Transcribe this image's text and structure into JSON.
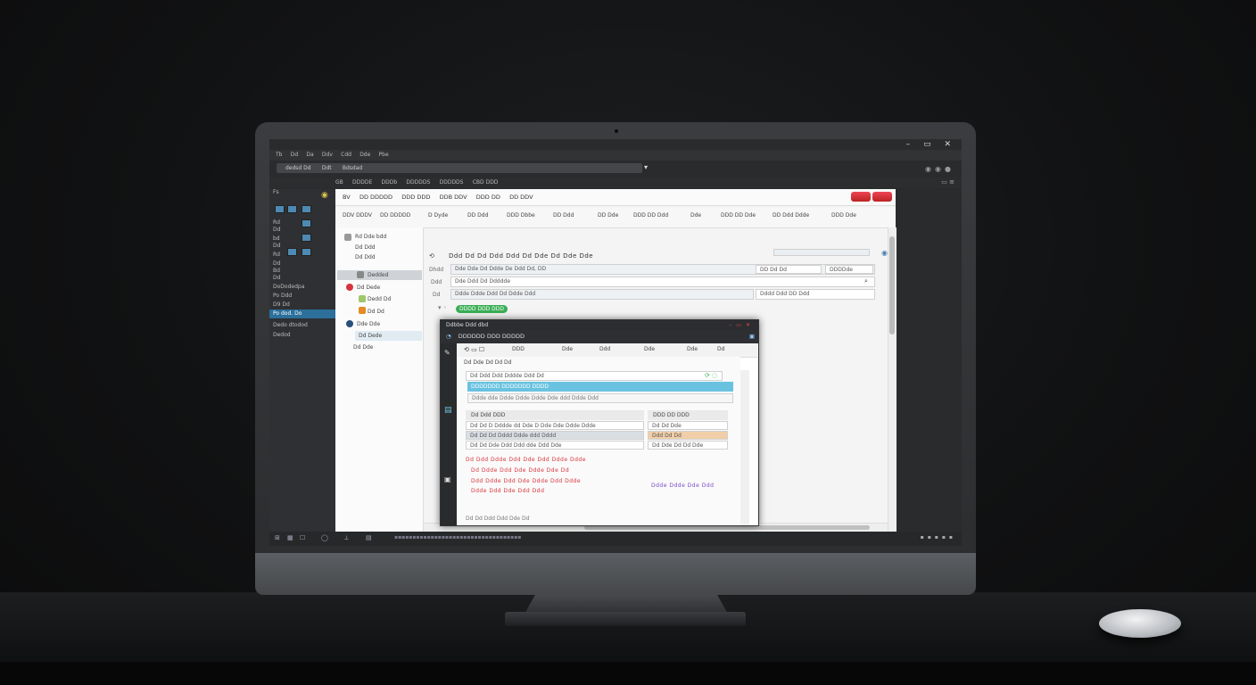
{
  "window": {
    "controls": "– ▭ ✕",
    "menu": [
      "Tb",
      "Dd",
      "Da",
      "Ddv",
      "Cdd",
      "Dde",
      "Pbe"
    ],
    "address": [
      "dedsd Dd",
      "Ddt",
      "Bdsdad"
    ],
    "toolbar": [
      "GB",
      "DDDDE",
      "DDDb",
      "DDDDDS",
      "DDDDDS",
      "CBD DDD"
    ]
  },
  "sidebar": {
    "items": [
      "Fs",
      "Rd",
      "Dd",
      "bd",
      "Dd",
      "Rd",
      "Dd",
      "Bd",
      "Dd",
      "DoDodedpa",
      "Po Ddd",
      "D9 Dd",
      "Po dod. Do",
      "Dedo dtodod",
      "Dedod"
    ]
  },
  "app": {
    "top_menu": [
      "BV",
      "DD DDDDD",
      "DDD DDD",
      "DDB DDV",
      "DDD DD",
      "DD DDV"
    ],
    "tabs": [
      "DDV DDDV",
      "DD DDDDD",
      "D Dyde",
      "DD Ddd",
      "DDD Dbbe",
      "DD Ddd",
      "DD Dde",
      "DDD DD Ddd",
      "Dde",
      "DDD DD Dde",
      "DD Ddd Ddde",
      "DDD Dde"
    ],
    "tree": [
      "Rd Dde bdd",
      "Dd Ddd",
      "Dd Ddd",
      "Dedded",
      "Dd Dede",
      "Dedd Dd",
      "Dd Dd",
      "Dde Dde",
      "Dd Dede",
      "Dd Dde"
    ],
    "heading": "Ddd Dd Dd Ddd Ddd Dd Dde Dd Dde Dde",
    "fields": [
      {
        "label": "Dhdd",
        "value": "Dde Dde Dd Ddde De Ddd Dd, DD",
        "right": "DD Dd  Dd",
        "right2": "DDDDde"
      },
      {
        "label": "Ddd",
        "value": "Dde Ddd Dd Ddddde",
        "right": ""
      },
      {
        "label": "Dd",
        "value": "Ddde Ddde Ddd Dd Ddde Ddd",
        "right": "Dddd Ddd  DD Ddd"
      }
    ],
    "pill": "DDDD DDD DDD"
  },
  "dialog": {
    "title": "Ddbbe Ddd dbd",
    "bar_title": "DDDDDD DDD DDDDD",
    "tabs": [
      "DDD",
      "Dde",
      "Ddd",
      "Dde",
      "Dde",
      "Dd"
    ],
    "search": "Dd Ddd  Ddd Dddde Ddd Dd",
    "blue_band": "DDDDDDD DDDDDDD DDDD",
    "sub": "Ddde dde Ddde Ddde Ddde Dde ddd Ddde Ddd",
    "panel_left_title": "Dd Ddd DDD",
    "panel_right_title": "DDD DD DDD",
    "panel_left_rows": [
      "Dd Dd D Dddde dd Dde D Dde Dde Ddde Ddde",
      "Dd Dd Dd Dddd Ddde ddd Dddd",
      "Dd Dd Dde Ddd Ddd dde Ddd Dde"
    ],
    "panel_right_rows": [
      "Dd Dd Dde",
      "Ddd Dd Dd",
      "Dd Dde Dd Dd Dde"
    ],
    "red_lines": [
      "Dd Ddd Ddde Ddd Dde Ddd Ddde Ddde",
      "Dd Ddde Ddd Dde Ddde Dde Dd",
      "Ddd Ddde Ddd Dde Ddde Ddd Ddde",
      "Ddde Ddd Dde Ddd Ddd"
    ],
    "blue_line": "Ddde Ddde Dde Ddd",
    "footer": "Dd Dd Ddd Ddd Dde Dd"
  },
  "taskbar": [
    "⊞",
    "▦",
    "☐",
    "◯",
    "⟂",
    "▤"
  ],
  "colors": {
    "accent": "#2b6f9a",
    "green": "#3bae56",
    "red": "#d8333b",
    "dialog_blue": "#69c2e0"
  }
}
